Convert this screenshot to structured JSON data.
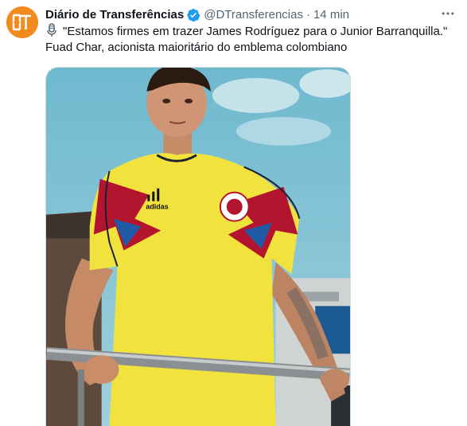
{
  "tweet": {
    "author_name": "Diário de Transferências",
    "handle": "@DTransferencias",
    "separator": "·",
    "timestamp": "14 min",
    "avatar_text": "DT",
    "verified": true,
    "text_line1": "\"Estamos firmes em trazer James Rodríguez para o Junior Barranquilla.\"",
    "text_line2": "Fuad Char, acionista maioritário do emblema colombiano"
  },
  "photo": {
    "jersey_brand": "adidas"
  },
  "colors": {
    "avatar_bg": "#f28a1e",
    "verified_blue": "#1d9bf0",
    "text_primary": "#0f1419",
    "text_secondary": "#536471",
    "jersey_yellow": "#f2e23e",
    "jersey_red": "#b3152e",
    "jersey_blue": "#1f5aa6"
  },
  "icons": {
    "verified": "verified-badge-icon",
    "more": "more-options-icon",
    "mic": "microphone-icon"
  }
}
